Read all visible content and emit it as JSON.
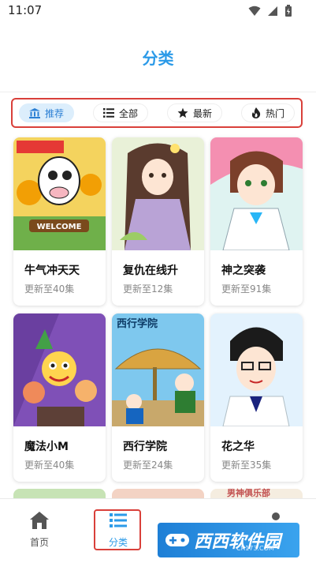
{
  "status": {
    "time": "11:07"
  },
  "page": {
    "title": "分类"
  },
  "filters": [
    {
      "label": "推荐",
      "icon": "bank-icon",
      "active": true
    },
    {
      "label": "全部",
      "icon": "list-icon",
      "active": false
    },
    {
      "label": "最新",
      "icon": "star-icon",
      "active": false
    },
    {
      "label": "热门",
      "icon": "flame-icon",
      "active": false
    }
  ],
  "comics": [
    {
      "title": "牛气冲天天",
      "subtitle": "更新至40集",
      "cover_text": "WELCOME"
    },
    {
      "title": "复仇在线升",
      "subtitle": "更新至12集"
    },
    {
      "title": "神之突袭",
      "subtitle": "更新至91集"
    },
    {
      "title": "魔法小M",
      "subtitle": "更新至40集"
    },
    {
      "title": "西行学院",
      "subtitle": "更新至24集",
      "cover_text": "西行学院"
    },
    {
      "title": "花之华",
      "subtitle": "更新至35集"
    }
  ],
  "peek_text": "男神俱乐部",
  "tabs": [
    {
      "label": "首页",
      "icon": "home-icon"
    },
    {
      "label": "分类",
      "icon": "list-icon",
      "active": true
    }
  ],
  "watermark": {
    "text": "西西软件园",
    "sub": "CR173.COM"
  },
  "colors": {
    "accent": "#2b9ae8",
    "highlight": "#d9403a"
  }
}
